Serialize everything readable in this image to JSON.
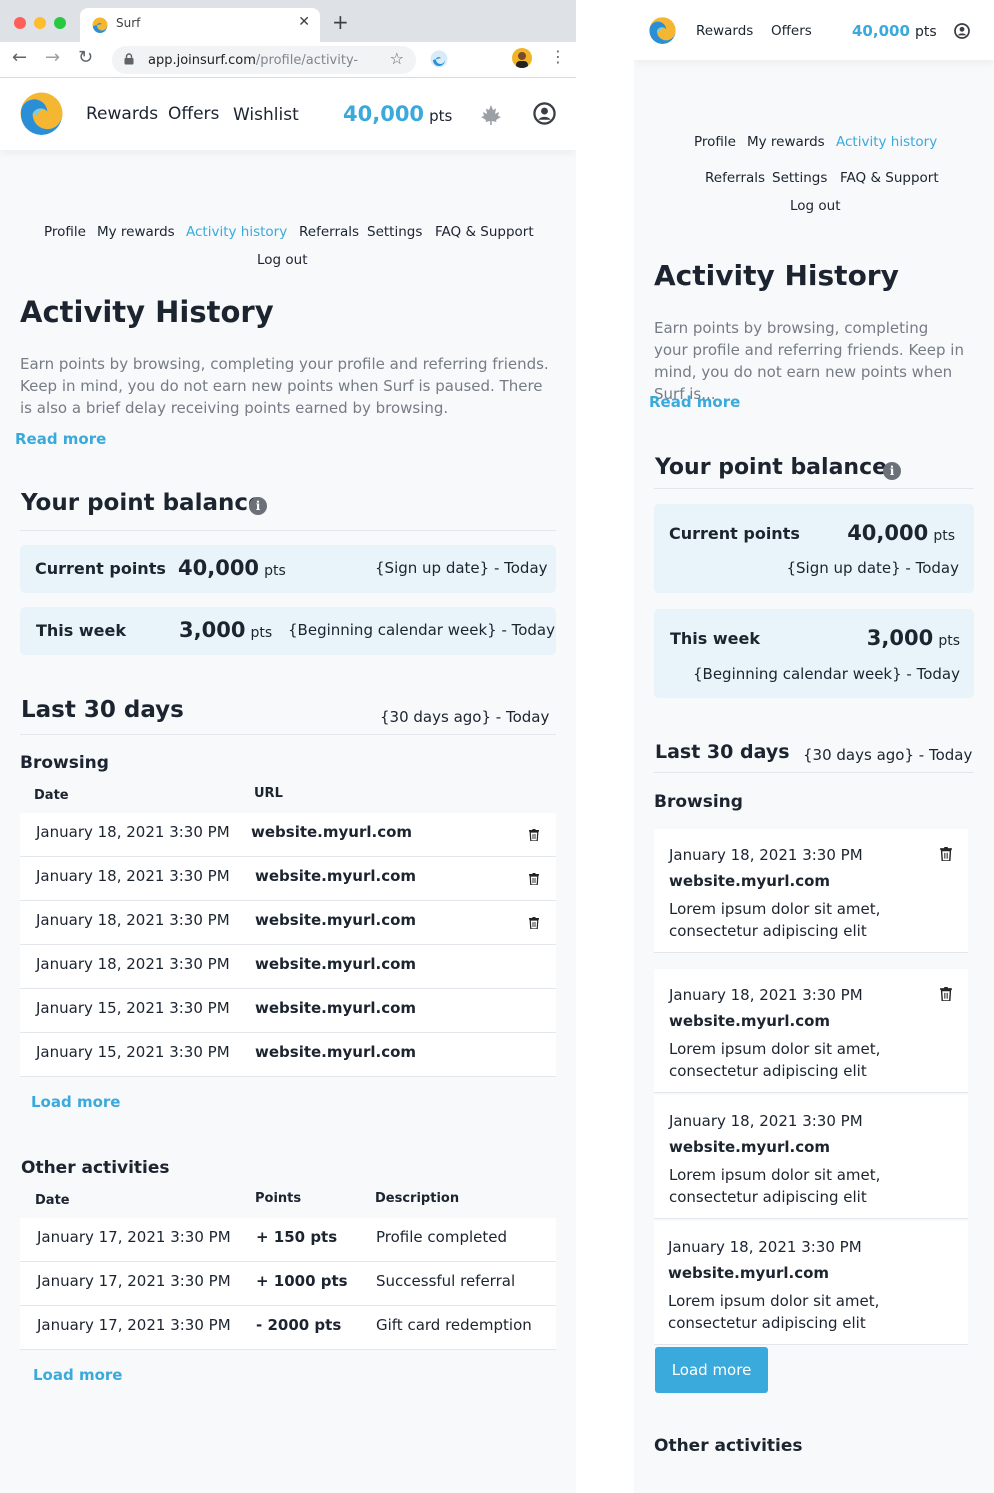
{
  "browser": {
    "tab_title": "Surf",
    "url_domain": "app.joinsurf.com",
    "url_path": "/profile/activity-",
    "colors": {
      "tab_bg": "#dee1e6",
      "close": "#ff5f57",
      "minimize": "#febc2e",
      "maximize": "#28c840"
    }
  },
  "header": {
    "nav": [
      "Rewards",
      "Offers",
      "Wishlist"
    ],
    "mobile_nav": [
      "Rewards",
      "Offers"
    ],
    "points_value": "40,000",
    "points_unit": "pts",
    "icons": [
      "maple-leaf-icon",
      "account-icon"
    ]
  },
  "subnav": {
    "items": [
      "Profile",
      "My rewards",
      "Activity history",
      "Referrals",
      "Settings",
      "FAQ & Support",
      "Log out"
    ],
    "active": "Activity history"
  },
  "page": {
    "title": "Activity History",
    "intro": "Earn points by browsing, completing your profile and referring friends. Keep in mind, you do not earn new points when Surf is paused. There is also a brief delay receiving points earned by browsing.",
    "intro_truncated": "Earn points by browsing, completing your profile and referring friends. Keep in mind, you do not earn new points when Surf is...",
    "read_more": "Read more"
  },
  "balance": {
    "title": "Your point balance",
    "current": {
      "label": "Current points",
      "value": "40,000",
      "unit": "pts",
      "range": "{Sign up date} - Today"
    },
    "week": {
      "label": "This week",
      "value": "3,000",
      "unit": "pts",
      "range": "{Beginning calendar week} - Today"
    }
  },
  "last30": {
    "title": "Last 30 days",
    "range": "{30 days ago} - Today"
  },
  "browsing": {
    "title": "Browsing",
    "columns": [
      "Date",
      "URL"
    ],
    "rows": [
      {
        "date": "January 18, 2021 3:30 PM",
        "url": "website.myurl.com"
      },
      {
        "date": "January 18, 2021 3:30 PM",
        "url": "website.myurl.com"
      },
      {
        "date": "January 18, 2021 3:30 PM",
        "url": "website.myurl.com"
      },
      {
        "date": "January 18, 2021 3:30 PM",
        "url": "website.myurl.com"
      },
      {
        "date": "January 15, 2021 3:30 PM",
        "url": "website.myurl.com"
      },
      {
        "date": "January 15, 2021 3:30 PM",
        "url": "website.myurl.com"
      }
    ],
    "mobile_rows": [
      {
        "date": "January 18, 2021 3:30 PM",
        "url": "website.myurl.com",
        "text": "Lorem ipsum dolor sit amet, consectetur adipiscing elit"
      },
      {
        "date": "January 18, 2021 3:30 PM",
        "url": "website.myurl.com",
        "text": "Lorem ipsum dolor sit amet, consectetur adipiscing elit"
      },
      {
        "date": "January 18, 2021 3:30 PM",
        "url": "website.myurl.com",
        "text": "Lorem ipsum dolor sit amet, consectetur adipiscing elit"
      },
      {
        "date": "January 18, 2021 3:30 PM",
        "url": "website.myurl.com",
        "text": "Lorem ipsum dolor sit amet, consectetur adipiscing elit"
      }
    ],
    "load_more": "Load more"
  },
  "other": {
    "title": "Other activities",
    "columns": [
      "Date",
      "Points",
      "Description"
    ],
    "rows": [
      {
        "date": "January 17, 2021 3:30 PM",
        "points": "+ 150 pts",
        "description": "Profile completed"
      },
      {
        "date": "January 17, 2021 3:30 PM",
        "points": "+ 1000 pts",
        "description": "Successful referral"
      },
      {
        "date": "January 17, 2021 3:30 PM",
        "points": "- 2000 pts",
        "description": "Gift card redemption"
      }
    ],
    "load_more": "Load more"
  },
  "theme": {
    "accent": "#3aa9dc",
    "card_bg": "#e9f3fa",
    "text": "#1c2430",
    "muted": "#767c85"
  }
}
